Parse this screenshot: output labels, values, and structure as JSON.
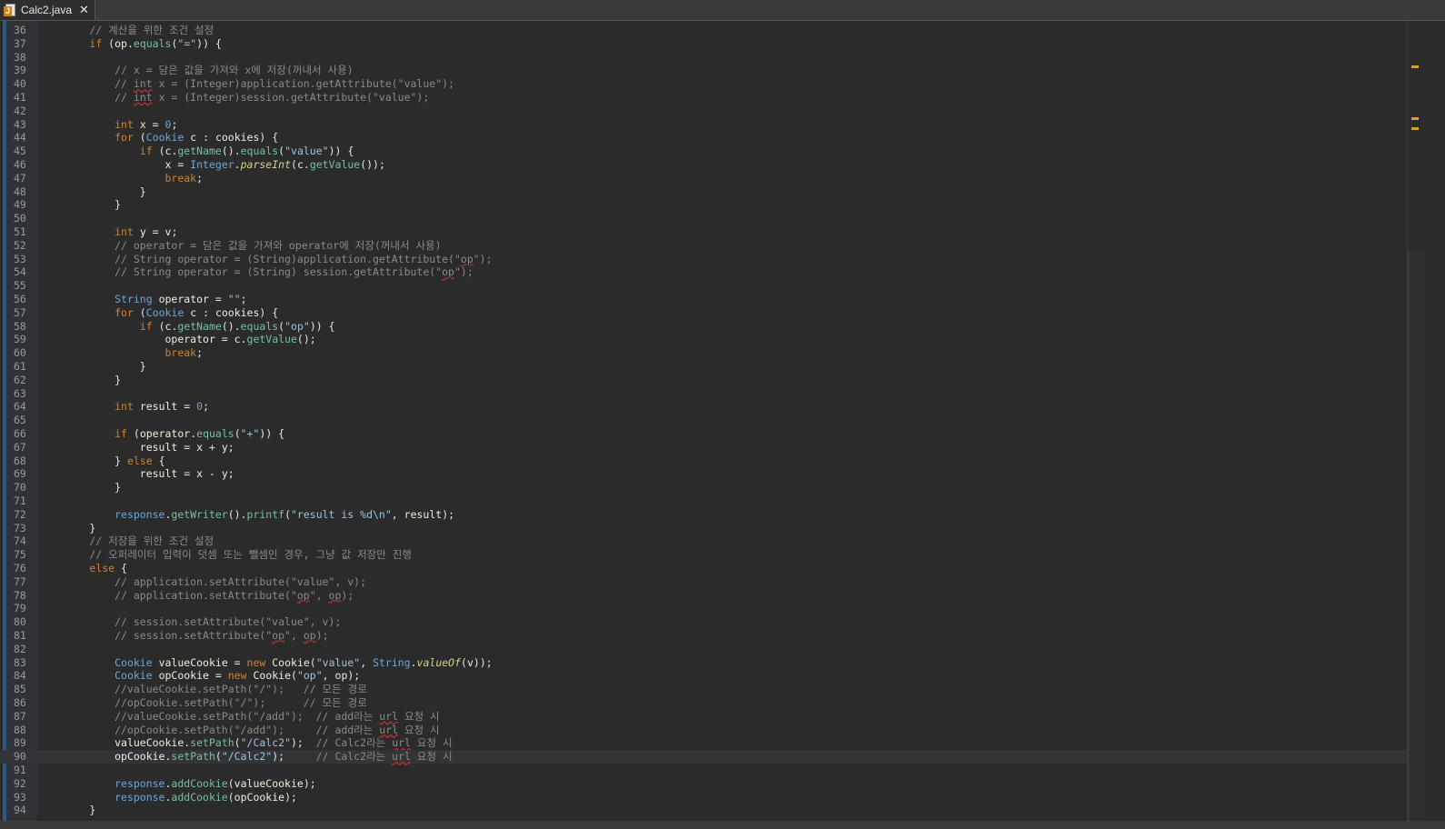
{
  "tab": {
    "title": "Calc2.java",
    "close_glyph": "✕",
    "icon": "java-file-icon",
    "icon_letter": "J"
  },
  "colors": {
    "background": "#2b2b2b",
    "keyword": "#cc8432",
    "type": "#6ca6d8",
    "method": "#77c19b",
    "string": "#9dc3da",
    "comment": "#8a8a8a",
    "variable": "#f0eedc",
    "marker": "#d7a12b"
  },
  "current_line": 90,
  "lines": [
    {
      "n": 36,
      "t": [
        [
          "cm",
          "        // 계산을 위한 조건 설정"
        ]
      ]
    },
    {
      "n": 37,
      "t": [
        [
          "",
          "        "
        ],
        [
          "kw",
          "if"
        ],
        [
          "",
          " ("
        ],
        [
          "va",
          "op"
        ],
        [
          "",
          "."
        ],
        [
          "me",
          "equals"
        ],
        [
          "",
          "("
        ],
        [
          "st",
          "\"=\""
        ],
        [
          "",
          ")) {"
        ]
      ]
    },
    {
      "n": 38,
      "t": []
    },
    {
      "n": 39,
      "t": [
        [
          "cm",
          "            // x = 담은 값을 가져와 x에 저장(꺼내서 사용)"
        ]
      ]
    },
    {
      "n": 40,
      "t": [
        [
          "cm",
          "            // "
        ],
        [
          "cm sq",
          "int"
        ],
        [
          "cm",
          " x = (Integer)application.getAttribute(\"value\");"
        ]
      ]
    },
    {
      "n": 41,
      "t": [
        [
          "cm",
          "            // "
        ],
        [
          "cm sq",
          "int"
        ],
        [
          "cm",
          " x = (Integer)session.getAttribute(\"value\");"
        ]
      ]
    },
    {
      "n": 42,
      "t": []
    },
    {
      "n": 43,
      "t": [
        [
          "",
          "            "
        ],
        [
          "kw",
          "int"
        ],
        [
          "",
          " "
        ],
        [
          "va",
          "x"
        ],
        [
          "",
          " = "
        ],
        [
          "nu",
          "0"
        ],
        [
          "",
          ";"
        ]
      ]
    },
    {
      "n": 44,
      "t": [
        [
          "",
          "            "
        ],
        [
          "kw",
          "for"
        ],
        [
          "",
          " ("
        ],
        [
          "ty",
          "Cookie"
        ],
        [
          "",
          " "
        ],
        [
          "va",
          "c"
        ],
        [
          "",
          " : "
        ],
        [
          "va",
          "cookies"
        ],
        [
          "",
          ") {"
        ]
      ]
    },
    {
      "n": 45,
      "t": [
        [
          "",
          "                "
        ],
        [
          "kw",
          "if"
        ],
        [
          "",
          " ("
        ],
        [
          "va",
          "c"
        ],
        [
          "",
          "."
        ],
        [
          "me",
          "getName"
        ],
        [
          "",
          "()."
        ],
        [
          "me",
          "equals"
        ],
        [
          "",
          "("
        ],
        [
          "st",
          "\"value\""
        ],
        [
          "",
          ")) {"
        ]
      ]
    },
    {
      "n": 46,
      "t": [
        [
          "",
          "                    "
        ],
        [
          "va",
          "x"
        ],
        [
          "",
          " = "
        ],
        [
          "ty",
          "Integer"
        ],
        [
          "",
          "."
        ],
        [
          "it",
          "parseInt"
        ],
        [
          "",
          "("
        ],
        [
          "va",
          "c"
        ],
        [
          "",
          "."
        ],
        [
          "me",
          "getValue"
        ],
        [
          "",
          "());"
        ]
      ]
    },
    {
      "n": 47,
      "t": [
        [
          "",
          "                    "
        ],
        [
          "kw",
          "break"
        ],
        [
          "",
          ";"
        ]
      ]
    },
    {
      "n": 48,
      "t": [
        [
          "",
          "                }"
        ]
      ]
    },
    {
      "n": 49,
      "t": [
        [
          "",
          "            }"
        ]
      ]
    },
    {
      "n": 50,
      "t": []
    },
    {
      "n": 51,
      "t": [
        [
          "",
          "            "
        ],
        [
          "kw",
          "int"
        ],
        [
          "",
          " "
        ],
        [
          "va",
          "y"
        ],
        [
          "",
          " = "
        ],
        [
          "va",
          "v"
        ],
        [
          "",
          ";"
        ]
      ]
    },
    {
      "n": 52,
      "t": [
        [
          "cm",
          "            // operator = 담은 값을 가져와 operator에 저장(꺼내서 사용)"
        ]
      ]
    },
    {
      "n": 53,
      "t": [
        [
          "cm",
          "            // String operator = (String)application.getAttribute(\""
        ],
        [
          "cm sq",
          "op"
        ],
        [
          "cm",
          "\");"
        ]
      ]
    },
    {
      "n": 54,
      "t": [
        [
          "cm",
          "            // String operator = (String) session.getAttribute(\""
        ],
        [
          "cm sq",
          "op"
        ],
        [
          "cm",
          "\");"
        ]
      ]
    },
    {
      "n": 55,
      "t": []
    },
    {
      "n": 56,
      "t": [
        [
          "",
          "            "
        ],
        [
          "ty",
          "String"
        ],
        [
          "",
          " "
        ],
        [
          "va",
          "operator"
        ],
        [
          "",
          " = "
        ],
        [
          "st",
          "\"\""
        ],
        [
          "",
          ";"
        ]
      ]
    },
    {
      "n": 57,
      "t": [
        [
          "",
          "            "
        ],
        [
          "kw",
          "for"
        ],
        [
          "",
          " ("
        ],
        [
          "ty",
          "Cookie"
        ],
        [
          "",
          " "
        ],
        [
          "va",
          "c"
        ],
        [
          "",
          " : "
        ],
        [
          "va",
          "cookies"
        ],
        [
          "",
          ") {"
        ]
      ]
    },
    {
      "n": 58,
      "t": [
        [
          "",
          "                "
        ],
        [
          "kw",
          "if"
        ],
        [
          "",
          " ("
        ],
        [
          "va",
          "c"
        ],
        [
          "",
          "."
        ],
        [
          "me",
          "getName"
        ],
        [
          "",
          "()."
        ],
        [
          "me",
          "equals"
        ],
        [
          "",
          "("
        ],
        [
          "st",
          "\"op\""
        ],
        [
          "",
          ")) {"
        ]
      ]
    },
    {
      "n": 59,
      "t": [
        [
          "",
          "                    "
        ],
        [
          "va",
          "operator"
        ],
        [
          "",
          " = "
        ],
        [
          "va",
          "c"
        ],
        [
          "",
          "."
        ],
        [
          "me",
          "getValue"
        ],
        [
          "",
          "();"
        ]
      ]
    },
    {
      "n": 60,
      "t": [
        [
          "",
          "                    "
        ],
        [
          "kw",
          "break"
        ],
        [
          "",
          ";"
        ]
      ]
    },
    {
      "n": 61,
      "t": [
        [
          "",
          "                }"
        ]
      ]
    },
    {
      "n": 62,
      "t": [
        [
          "",
          "            }"
        ]
      ]
    },
    {
      "n": 63,
      "t": []
    },
    {
      "n": 64,
      "t": [
        [
          "",
          "            "
        ],
        [
          "kw",
          "int"
        ],
        [
          "",
          " "
        ],
        [
          "va",
          "result"
        ],
        [
          "",
          " = "
        ],
        [
          "nu",
          "0"
        ],
        [
          "",
          ";"
        ]
      ]
    },
    {
      "n": 65,
      "t": []
    },
    {
      "n": 66,
      "t": [
        [
          "",
          "            "
        ],
        [
          "kw",
          "if"
        ],
        [
          "",
          " ("
        ],
        [
          "va",
          "operator"
        ],
        [
          "",
          "."
        ],
        [
          "me",
          "equals"
        ],
        [
          "",
          "("
        ],
        [
          "st",
          "\"+\""
        ],
        [
          "",
          ")) {"
        ]
      ]
    },
    {
      "n": 67,
      "t": [
        [
          "",
          "                "
        ],
        [
          "va",
          "result"
        ],
        [
          "",
          " = "
        ],
        [
          "va",
          "x"
        ],
        [
          "",
          " + "
        ],
        [
          "va",
          "y"
        ],
        [
          "",
          ";"
        ]
      ]
    },
    {
      "n": 68,
      "t": [
        [
          "",
          "            } "
        ],
        [
          "kw",
          "else"
        ],
        [
          "",
          " {"
        ]
      ]
    },
    {
      "n": 69,
      "t": [
        [
          "",
          "                "
        ],
        [
          "va",
          "result"
        ],
        [
          "",
          " = "
        ],
        [
          "va",
          "x"
        ],
        [
          "",
          " - "
        ],
        [
          "va",
          "y"
        ],
        [
          "",
          ";"
        ]
      ]
    },
    {
      "n": 70,
      "t": [
        [
          "",
          "            }"
        ]
      ]
    },
    {
      "n": 71,
      "t": []
    },
    {
      "n": 72,
      "t": [
        [
          "",
          "            "
        ],
        [
          "ty",
          "response"
        ],
        [
          "",
          "."
        ],
        [
          "me",
          "getWriter"
        ],
        [
          "",
          "()."
        ],
        [
          "me",
          "printf"
        ],
        [
          "",
          "("
        ],
        [
          "st",
          "\"result is %d\\n\""
        ],
        [
          "",
          ", "
        ],
        [
          "va",
          "result"
        ],
        [
          "",
          ");"
        ]
      ]
    },
    {
      "n": 73,
      "t": [
        [
          "",
          "        }"
        ]
      ]
    },
    {
      "n": 74,
      "t": [
        [
          "cm",
          "        // 저장을 위한 조건 설정"
        ]
      ]
    },
    {
      "n": 75,
      "t": [
        [
          "cm",
          "        // 오퍼레이터 입력이 덧셈 또는 뺄셈인 경우, 그냥 값 저장만 진행"
        ]
      ]
    },
    {
      "n": 76,
      "t": [
        [
          "",
          "        "
        ],
        [
          "kw",
          "else"
        ],
        [
          "",
          " {"
        ]
      ]
    },
    {
      "n": 77,
      "t": [
        [
          "cm",
          "            // application.setAttribute(\"value\", v);"
        ]
      ]
    },
    {
      "n": 78,
      "t": [
        [
          "cm",
          "            // application.setAttribute(\""
        ],
        [
          "cm sq",
          "op"
        ],
        [
          "cm",
          "\", "
        ],
        [
          "cm sq",
          "op"
        ],
        [
          "cm",
          ");"
        ]
      ]
    },
    {
      "n": 79,
      "t": []
    },
    {
      "n": 80,
      "t": [
        [
          "cm",
          "            // session.setAttribute(\"value\", v);"
        ]
      ]
    },
    {
      "n": 81,
      "t": [
        [
          "cm",
          "            // session.setAttribute(\""
        ],
        [
          "cm sq",
          "op"
        ],
        [
          "cm",
          "\", "
        ],
        [
          "cm sq",
          "op"
        ],
        [
          "cm",
          ");"
        ]
      ]
    },
    {
      "n": 82,
      "t": []
    },
    {
      "n": 83,
      "t": [
        [
          "",
          "            "
        ],
        [
          "ty",
          "Cookie"
        ],
        [
          "",
          " "
        ],
        [
          "va",
          "valueCookie"
        ],
        [
          "",
          " = "
        ],
        [
          "kw",
          "new"
        ],
        [
          "",
          " "
        ],
        [
          "va",
          "Cookie"
        ],
        [
          "",
          "("
        ],
        [
          "st",
          "\"value\""
        ],
        [
          "",
          ", "
        ],
        [
          "ty",
          "String"
        ],
        [
          "",
          "."
        ],
        [
          "it",
          "valueOf"
        ],
        [
          "",
          "("
        ],
        [
          "va",
          "v"
        ],
        [
          "",
          "));"
        ]
      ]
    },
    {
      "n": 84,
      "t": [
        [
          "",
          "            "
        ],
        [
          "ty",
          "Cookie"
        ],
        [
          "",
          " "
        ],
        [
          "va",
          "opCookie"
        ],
        [
          "",
          " = "
        ],
        [
          "kw",
          "new"
        ],
        [
          "",
          " "
        ],
        [
          "va",
          "Cookie"
        ],
        [
          "",
          "("
        ],
        [
          "st",
          "\"op\""
        ],
        [
          "",
          ", "
        ],
        [
          "va",
          "op"
        ],
        [
          "",
          ");"
        ]
      ]
    },
    {
      "n": 85,
      "t": [
        [
          "cm",
          "            //valueCookie.setPath(\"/\");   // 모든 경로"
        ]
      ]
    },
    {
      "n": 86,
      "t": [
        [
          "cm",
          "            //opCookie.setPath(\"/\");      // 모든 경로"
        ]
      ]
    },
    {
      "n": 87,
      "t": [
        [
          "cm",
          "            //valueCookie.setPath(\"/add\");  // add라는 "
        ],
        [
          "cm sq",
          "url"
        ],
        [
          "cm",
          " 요청 시"
        ]
      ]
    },
    {
      "n": 88,
      "t": [
        [
          "cm",
          "            //opCookie.setPath(\"/add\");     // add라는 "
        ],
        [
          "cm sq",
          "url"
        ],
        [
          "cm",
          " 요청 시"
        ]
      ]
    },
    {
      "n": 89,
      "t": [
        [
          "",
          "            "
        ],
        [
          "va",
          "valueCookie"
        ],
        [
          "",
          "."
        ],
        [
          "me",
          "setPath"
        ],
        [
          "",
          "("
        ],
        [
          "st",
          "\"/Calc2\""
        ],
        [
          "",
          ");  "
        ],
        [
          "cm",
          "// Calc2라는 "
        ],
        [
          "cm sq",
          "url"
        ],
        [
          "cm",
          " 요청 시"
        ]
      ]
    },
    {
      "n": 90,
      "t": [
        [
          "",
          "            "
        ],
        [
          "va",
          "opCookie"
        ],
        [
          "",
          "."
        ],
        [
          "me",
          "setPath"
        ],
        [
          "",
          "("
        ],
        [
          "st",
          "\"/Calc2\""
        ],
        [
          "",
          ");     "
        ],
        [
          "cm",
          "// Calc2라는 "
        ],
        [
          "cm sq",
          "url"
        ],
        [
          "cm",
          " 요청 시"
        ]
      ]
    },
    {
      "n": 91,
      "t": []
    },
    {
      "n": 92,
      "t": [
        [
          "",
          "            "
        ],
        [
          "ty",
          "response"
        ],
        [
          "",
          "."
        ],
        [
          "me",
          "addCookie"
        ],
        [
          "",
          "("
        ],
        [
          "va",
          "valueCookie"
        ],
        [
          "",
          ");"
        ]
      ]
    },
    {
      "n": 93,
      "t": [
        [
          "",
          "            "
        ],
        [
          "ty",
          "response"
        ],
        [
          "",
          "."
        ],
        [
          "me",
          "addCookie"
        ],
        [
          "",
          "("
        ],
        [
          "va",
          "opCookie"
        ],
        [
          "",
          ");"
        ]
      ]
    },
    {
      "n": 94,
      "t": [
        [
          "",
          "        }"
        ]
      ]
    }
  ]
}
